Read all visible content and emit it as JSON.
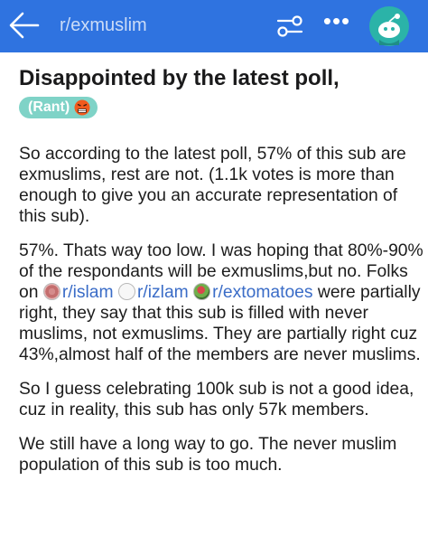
{
  "header": {
    "subreddit": "r/exmuslim",
    "back_icon": "back-arrow-icon",
    "filter_icon": "filter-icon",
    "more_icon": "more-icon",
    "more_glyph": "•••",
    "avatar_icon": "snoo-avatar-icon",
    "bar_color": "#2f73e0"
  },
  "post": {
    "title": "Disappointed by the latest poll,",
    "flair": {
      "label": "(Rant)",
      "emoji": "angry-face-icon",
      "color": "#7fd3c7"
    },
    "paragraphs": {
      "p1": "So according to the latest poll, 57% of this sub are exmuslims, rest are not. (1.1k  votes is more than enough to give you an accurate representation of this sub).",
      "p2_a": "57%. Thats way too low. I was hoping that 80%-90% of the respondants will be exmuslims,but no. Folks on ",
      "p2_link1": "r/islam",
      "p2_link2": "r/izlam",
      "p2_link3": "r/extomatoes",
      "p2_b": " were partially right, they say that this sub is filled with never muslims, not exmuslims. They are partially right cuz 43%,almost half of the members are never muslims.",
      "p3": "So I guess celebrating 100k sub is not a good idea, cuz in reality, this sub has only 57k members.",
      "p4": "We still have a long way to go. The never muslim population of this sub is too much."
    }
  }
}
